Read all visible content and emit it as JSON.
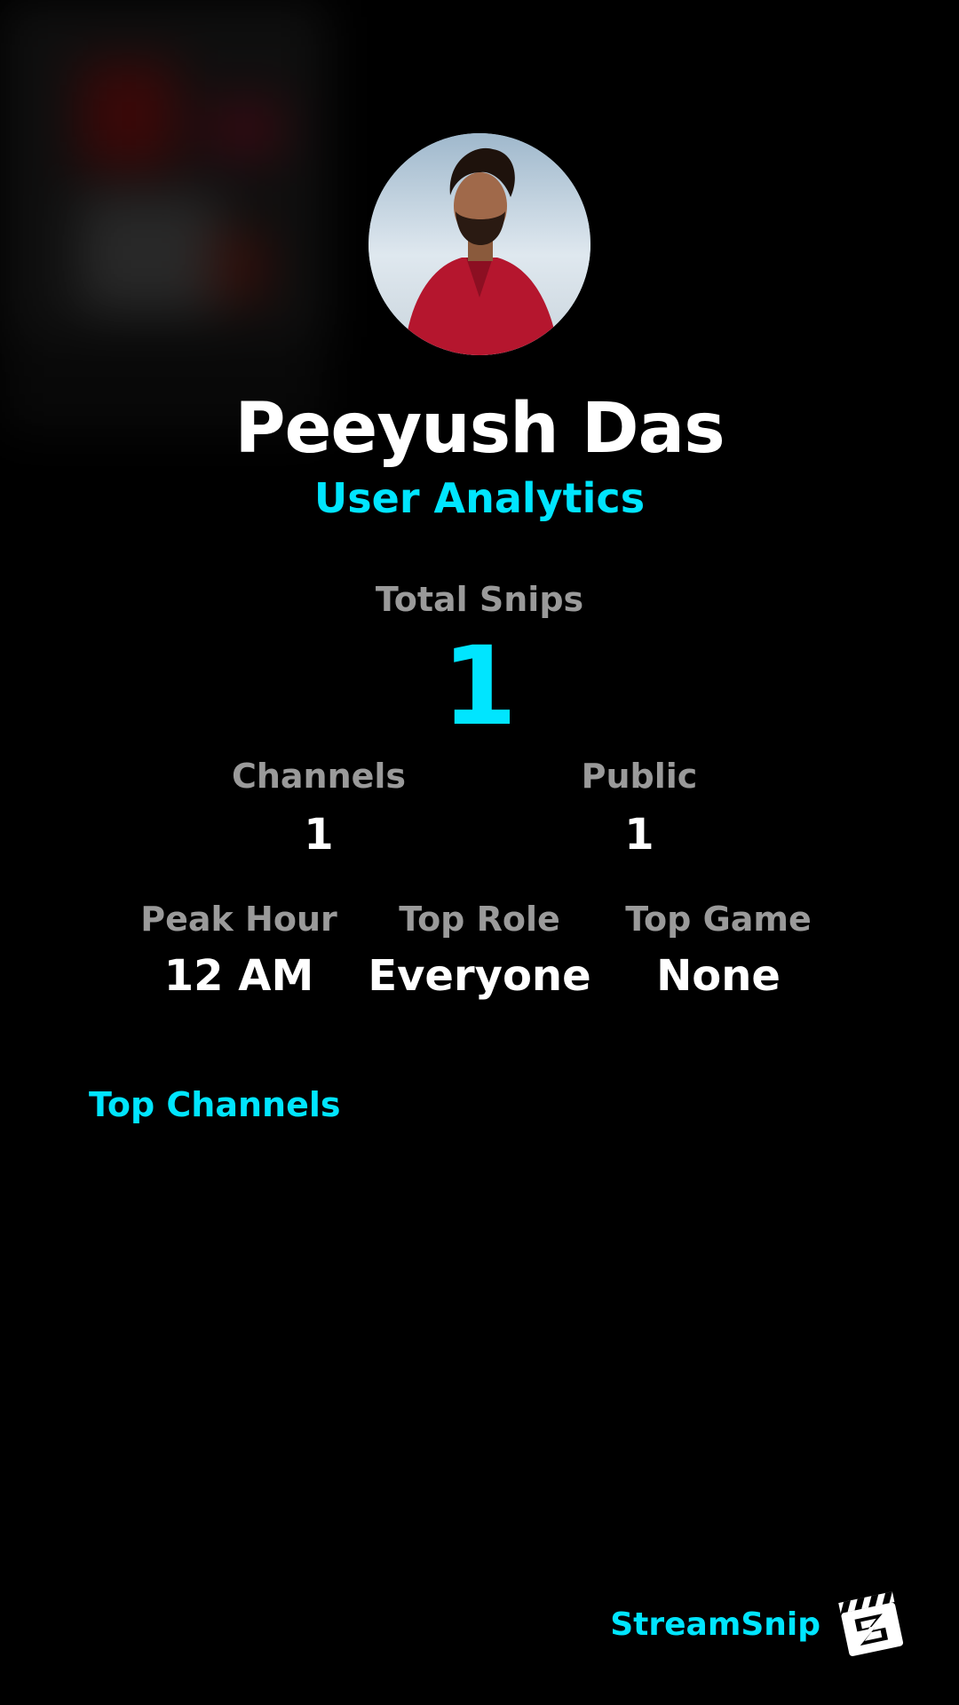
{
  "profile": {
    "name": "Peeyush Das",
    "subtitle": "User Analytics",
    "avatar_icon": "user-photo"
  },
  "stats": {
    "total_snips_label": "Total Snips",
    "total_snips_value": "1",
    "channels_label": "Channels",
    "channels_value": "1",
    "public_label": "Public",
    "public_value": "1",
    "peak_hour_label": "Peak Hour",
    "peak_hour_value": "12 AM",
    "top_role_label": "Top Role",
    "top_role_value": "Everyone",
    "top_game_label": "Top Game",
    "top_game_value": "None"
  },
  "sections": {
    "top_channels_label": "Top Channels"
  },
  "branding": {
    "name": "StreamSnip",
    "logo_icon": "clapperboard-logo"
  },
  "colors": {
    "accent": "#00e5ff",
    "background": "#000000",
    "label_gray": "#9a9a9a",
    "text": "#ffffff"
  }
}
